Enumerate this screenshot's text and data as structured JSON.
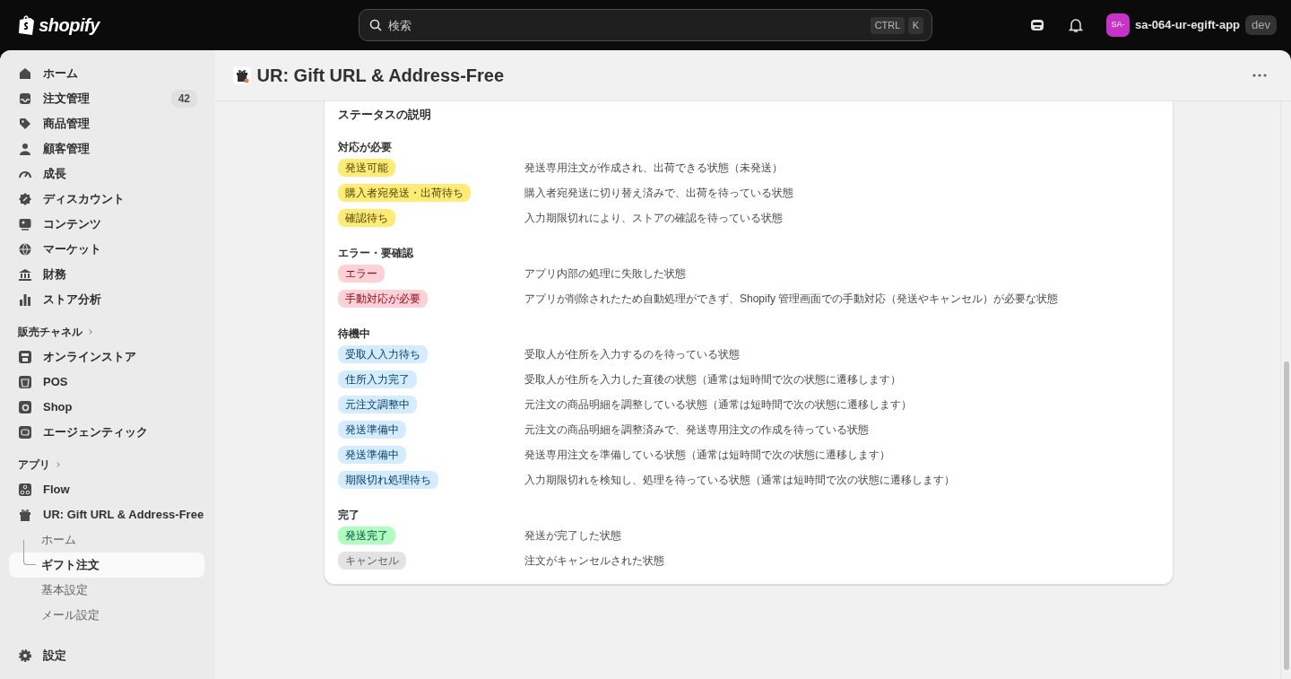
{
  "topbar": {
    "logo": "shopify",
    "search": {
      "placeholder": "検索",
      "shortcut": [
        "CTRL",
        "K"
      ]
    },
    "store": {
      "avatar": "SA-",
      "name": "sa-064-ur-egift-app",
      "badge": "dev"
    }
  },
  "sidebar": {
    "main_items": [
      {
        "label": "ホーム",
        "selected": false
      },
      {
        "label": "注文管理",
        "count": "42",
        "selected": false
      },
      {
        "label": "商品管理",
        "selected": false
      },
      {
        "label": "顧客管理",
        "selected": false
      },
      {
        "label": "成長",
        "selected": false
      },
      {
        "label": "ディスカウント",
        "selected": false
      },
      {
        "label": "コンテンツ",
        "selected": false
      },
      {
        "label": "マーケット",
        "selected": false
      },
      {
        "label": "財務",
        "selected": false
      },
      {
        "label": "ストア分析",
        "selected": false
      }
    ],
    "sales_channels": {
      "heading": "販売チャネル",
      "items": [
        {
          "label": "オンラインストア",
          "selected": false
        },
        {
          "label": "POS",
          "selected": false
        },
        {
          "label": "Shop",
          "selected": false
        },
        {
          "label": "エージェンティック",
          "selected": false
        }
      ]
    },
    "apps": {
      "heading": "アプリ",
      "items": [
        {
          "label": "Flow",
          "selected": false
        },
        {
          "label": "UR: Gift URL & Address-Free",
          "selected": false,
          "children": [
            {
              "label": "ホーム",
              "selected": false
            },
            {
              "label": "ギフト注文",
              "selected": true
            },
            {
              "label": "基本設定",
              "selected": false
            },
            {
              "label": "メール設定",
              "selected": false
            }
          ]
        }
      ]
    },
    "settings": {
      "label": "設定"
    }
  },
  "page": {
    "title": "UR: Gift URL & Address-Free"
  },
  "card": {
    "title": "ステータスの説明",
    "groups": [
      {
        "title": "対応が必要",
        "statuses": [
          {
            "label": "発送可能",
            "color": "#ffeb78",
            "description": "発送専用注文が作成され、出荷できる状態（未発送）"
          },
          {
            "label": "購入者宛発送・出荷待ち",
            "color": "#ffeb78",
            "description": "購入者宛発送に切り替え済みで、出荷を待っている状態"
          },
          {
            "label": "確認待ち",
            "color": "#ffeb78",
            "description": "入力期限切れにより、ストアの確認を待っている状態"
          }
        ]
      },
      {
        "title": "エラー・要確認",
        "statuses": [
          {
            "label": "エラー",
            "color": "#fed1d7",
            "description": "アプリ内部の処理に失敗した状態"
          },
          {
            "label": "手動対応が必要",
            "color": "#fed1d7",
            "description": "アプリが削除されたため自動処理ができず、Shopify 管理画面での手動対応（発送やキャンセル）が必要な状態"
          }
        ]
      },
      {
        "title": "待機中",
        "statuses": [
          {
            "label": "受取人入力待ち",
            "color": "#d5ebff",
            "description": "受取人が住所を入力するのを待っている状態"
          },
          {
            "label": "住所入力完了",
            "color": "#d5ebff",
            "description": "受取人が住所を入力した直後の状態（通常は短時間で次の状態に遷移します）"
          },
          {
            "label": "元注文調整中",
            "color": "#d5ebff",
            "description": "元注文の商品明細を調整している状態（通常は短時間で次の状態に遷移します）"
          },
          {
            "label": "発送準備中",
            "color": "#d5ebff",
            "description": "元注文の商品明細を調整済みで、発送専用注文の作成を待っている状態"
          },
          {
            "label": "発送準備中",
            "color": "#d5ebff",
            "description": "発送専用注文を準備している状態（通常は短時間で次の状態に遷移します）"
          },
          {
            "label": "期限切れ処理待ち",
            "color": "#d5ebff",
            "description": "入力期限切れを検知し、処理を待っている状態（通常は短時間で次の状態に遷移します）"
          }
        ]
      },
      {
        "title": "完了",
        "statuses": [
          {
            "label": "発送完了",
            "color": "#affebf",
            "description": "発送が完了した状態"
          },
          {
            "label": "キャンセル",
            "color": "#e3e3e3",
            "description": "注文がキャンセルされた状態"
          }
        ]
      }
    ]
  }
}
